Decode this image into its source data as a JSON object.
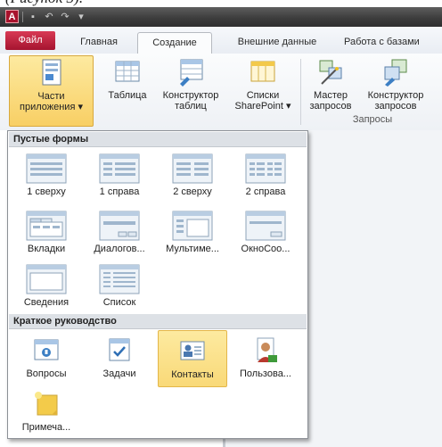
{
  "caption": "(Рисунок 3).",
  "tabs": {
    "file": "Файл",
    "home": "Главная",
    "create": "Создание",
    "external": "Внешние данные",
    "database": "Работа с базами"
  },
  "ribbon": {
    "parts_line1": "Части",
    "parts_line2": "приложения ▾",
    "table": "Таблица",
    "constructor_line1": "Конструктор",
    "constructor_line2": "таблиц",
    "lists_line1": "Списки",
    "lists_line2": "SharePoint ▾",
    "qwizard_line1": "Мастер",
    "qwizard_line2": "запросов",
    "qdesign_line1": "Конструктор",
    "qdesign_line2": "запросов",
    "queries_group": "Запросы"
  },
  "gallery": {
    "blank_header": "Пустые формы",
    "quickstart_header": "Краткое руководство",
    "blank_items": [
      "1 сверху",
      "1 справа",
      "2 сверху",
      "2 справа",
      "Вкладки",
      "Диалогов...",
      "Мультиме...",
      "ОкноСоо...",
      "Сведения",
      "Список"
    ],
    "quick_items": [
      "Вопросы",
      "Задачи",
      "Контакты",
      "Пользова...",
      "Примеча..."
    ],
    "selected": "Контакты"
  },
  "colors": {
    "file_tab": "#b8193a",
    "highlight": "#f8cf64",
    "titlebar": "#3d3d3d"
  }
}
